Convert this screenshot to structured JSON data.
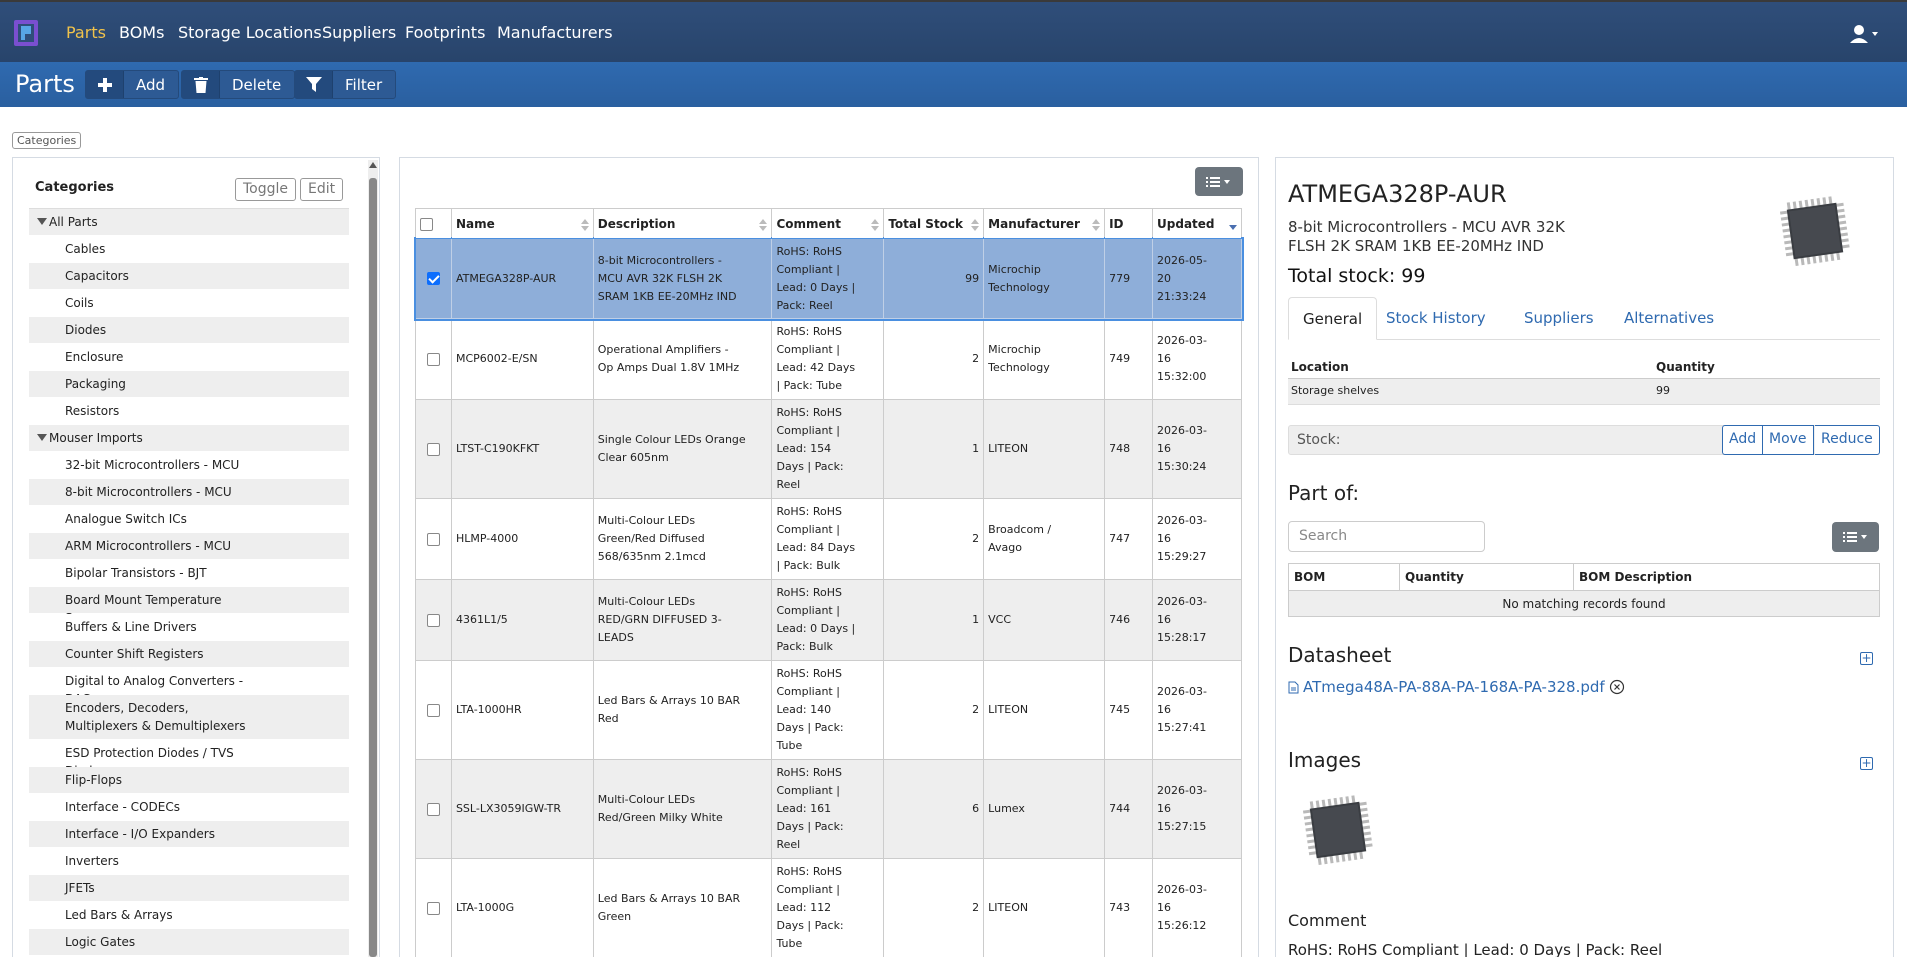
{
  "nav": {
    "items": [
      "Parts",
      "BOMs",
      "Storage Locations",
      "Suppliers",
      "Footprints",
      "Manufacturers"
    ]
  },
  "toolbar": {
    "title": "Parts",
    "add_label": "Add",
    "delete_label": "Delete",
    "filter_label": "Filter"
  },
  "categories_tag": "Categories",
  "categories": {
    "title": "Categories",
    "toggle_label": "Toggle",
    "edit_label": "Edit",
    "groups": [
      {
        "label": "All Parts",
        "items": [
          "Cables",
          "Capacitors",
          "Coils",
          "Diodes",
          "Enclosure",
          "Packaging",
          "Resistors"
        ]
      },
      {
        "label": "Mouser Imports",
        "items": [
          "32-bit Microcontrollers - MCU",
          "8-bit Microcontrollers - MCU",
          "Analogue Switch ICs",
          "ARM Microcontrollers - MCU",
          "Bipolar Transistors - BJT",
          "Board Mount Temperature Sensors",
          "Buffers & Line Drivers",
          "Counter Shift Registers",
          "Digital to Analog Converters - DAC",
          "Encoders, Decoders, Multiplexers & Demultiplexers",
          "ESD Protection Diodes / TVS Diodes",
          "Flip-Flops",
          "Interface - CODECs",
          "Interface - I/O Expanders",
          "Inverters",
          "JFETs",
          "Led Bars & Arrays",
          "Logic Gates"
        ]
      }
    ]
  },
  "parts_table": {
    "columns": [
      "Name",
      "Description",
      "Comment",
      "Total Stock",
      "Manufacturer",
      "ID",
      "Updated"
    ],
    "rows": [
      {
        "selected": true,
        "name": "ATMEGA328P-AUR",
        "description": [
          "8-bit Microcontrollers -",
          "MCU AVR 32K FLSH 2K",
          "SRAM 1KB EE-20MHz IND"
        ],
        "comment": [
          "RoHS: RoHS",
          "Compliant |",
          "Lead: 0 Days |",
          "Pack: Reel"
        ],
        "stock": "99",
        "manufacturer": [
          "Microchip",
          "Technology"
        ],
        "id": "779",
        "updated": [
          "2026-05-",
          "20",
          "21:33:24"
        ]
      },
      {
        "selected": false,
        "name": "MCP6002-E/SN",
        "description": [
          "Operational Amplifiers -",
          "Op Amps Dual 1.8V 1MHz"
        ],
        "comment": [
          "RoHS: RoHS",
          "Compliant |",
          "Lead: 42 Days",
          "| Pack: Tube"
        ],
        "stock": "2",
        "manufacturer": [
          "Microchip",
          "Technology"
        ],
        "id": "749",
        "updated": [
          "2026-03-",
          "16",
          "15:32:00"
        ]
      },
      {
        "selected": false,
        "name": "LTST-C190KFKT",
        "description": [
          "Single Colour LEDs Orange",
          "Clear 605nm"
        ],
        "comment": [
          "RoHS: RoHS",
          "Compliant |",
          "Lead: 154",
          "Days | Pack:",
          "Reel"
        ],
        "stock": "1",
        "manufacturer": [
          "LITEON"
        ],
        "id": "748",
        "updated": [
          "2026-03-",
          "16",
          "15:30:24"
        ]
      },
      {
        "selected": false,
        "name": "HLMP-4000",
        "description": [
          "Multi-Colour LEDs",
          "Green/Red Diffused",
          "568/635nm 2.1mcd"
        ],
        "comment": [
          "RoHS: RoHS",
          "Compliant |",
          "Lead: 84 Days",
          "| Pack: Bulk"
        ],
        "stock": "2",
        "manufacturer": [
          "Broadcom /",
          "Avago"
        ],
        "id": "747",
        "updated": [
          "2026-03-",
          "16",
          "15:29:27"
        ]
      },
      {
        "selected": false,
        "name": "4361L1/5",
        "description": [
          "Multi-Colour LEDs",
          "RED/GRN DIFFUSED 3-",
          "LEADS"
        ],
        "comment": [
          "RoHS: RoHS",
          "Compliant |",
          "Lead: 0 Days |",
          "Pack: Bulk"
        ],
        "stock": "1",
        "manufacturer": [
          "VCC"
        ],
        "id": "746",
        "updated": [
          "2026-03-",
          "16",
          "15:28:17"
        ]
      },
      {
        "selected": false,
        "name": "LTA-1000HR",
        "description": [
          "Led Bars & Arrays 10 BAR",
          "Red"
        ],
        "comment": [
          "RoHS: RoHS",
          "Compliant |",
          "Lead: 140",
          "Days | Pack:",
          "Tube"
        ],
        "stock": "2",
        "manufacturer": [
          "LITEON"
        ],
        "id": "745",
        "updated": [
          "2026-03-",
          "16",
          "15:27:41"
        ]
      },
      {
        "selected": false,
        "name": "SSL-LX3059IGW-TR",
        "description": [
          "Multi-Colour LEDs",
          "Red/Green Milky White"
        ],
        "comment": [
          "RoHS: RoHS",
          "Compliant |",
          "Lead: 161",
          "Days | Pack:",
          "Reel"
        ],
        "stock": "6",
        "manufacturer": [
          "Lumex"
        ],
        "id": "744",
        "updated": [
          "2026-03-",
          "16",
          "15:27:15"
        ]
      },
      {
        "selected": false,
        "name": "LTA-1000G",
        "description": [
          "Led Bars & Arrays 10 BAR",
          "Green"
        ],
        "comment": [
          "RoHS: RoHS",
          "Compliant |",
          "Lead: 112",
          "Days | Pack:",
          "Tube"
        ],
        "stock": "2",
        "manufacturer": [
          "LITEON"
        ],
        "id": "743",
        "updated": [
          "2026-03-",
          "16",
          "15:26:12"
        ]
      }
    ]
  },
  "detail": {
    "title": "ATMEGA328P-AUR",
    "description": "8-bit Microcontrollers - MCU AVR 32K FLSH 2K SRAM 1KB EE-20MHz IND",
    "total_stock": "Total stock: 99",
    "tabs": [
      "General",
      "Stock History",
      "Suppliers",
      "Alternatives"
    ],
    "location_header": "Location",
    "quantity_header": "Quantity",
    "location_value": "Storage shelves",
    "quantity_value": "99",
    "stock_label": "Stock:",
    "stock_add": "Add",
    "stock_move": "Move",
    "stock_reduce": "Reduce",
    "part_of_title": "Part of:",
    "search_placeholder": "Search",
    "bom_columns": [
      "BOM",
      "Quantity",
      "BOM Description"
    ],
    "bom_empty": "No matching records found",
    "datasheet_title": "Datasheet",
    "datasheet_file": "ATmega48A-PA-88A-PA-168A-PA-328.pdf",
    "images_title": "Images",
    "comment_title": "Comment",
    "comment_text": "RoHS: RoHS Compliant | Lead: 0 Days | Pack: Reel"
  }
}
